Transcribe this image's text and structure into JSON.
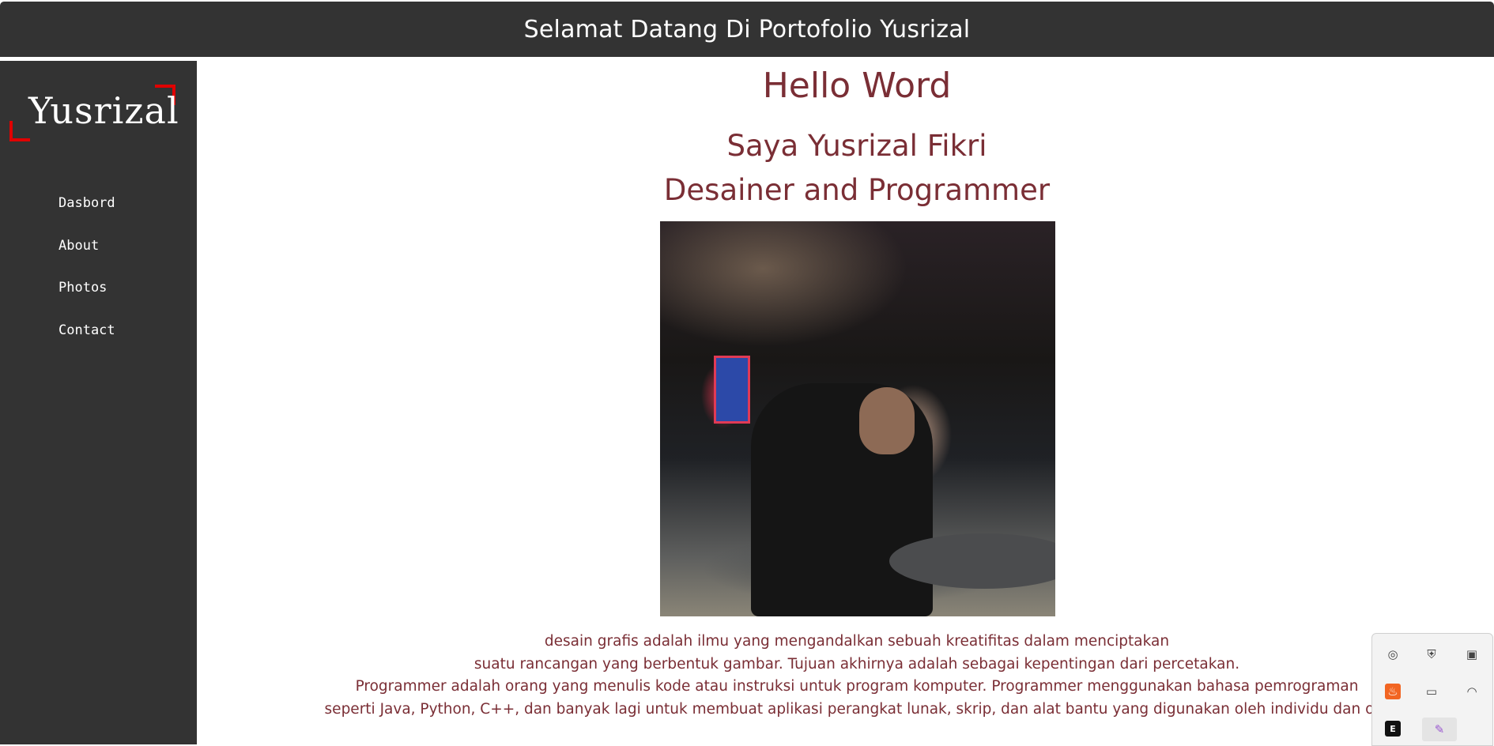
{
  "header": {
    "title": "Selamat Datang Di Portofolio Yusrizal"
  },
  "sidebar": {
    "logo_text": "Yusrizal",
    "items": [
      {
        "label": "Dasbord"
      },
      {
        "label": "About"
      },
      {
        "label": "Photos"
      },
      {
        "label": "Contact"
      }
    ]
  },
  "main": {
    "greeting": "Hello Word",
    "name_line": "Saya Yusrizal Fikri",
    "role_line": "Desainer and Programmer",
    "photo_alt": "photo",
    "description_lines": [
      "desain grafis adalah ilmu yang mengandalkan sebuah kreatifitas dalam menciptakan",
      "suatu rancangan yang berbentuk gambar. Tujuan akhirnya adalah sebagai kepentingan dari percetakan.",
      "Programmer adalah orang yang menulis kode atau instruksi untuk program komputer. Programmer menggunakan bahasa pemrograman",
      "seperti Java, Python, C++, dan banyak lagi untuk membuat aplikasi perangkat lunak, skrip, dan alat bantu yang digunakan oleh individu dan org"
    ]
  },
  "system_tray": {
    "icons": [
      {
        "name": "headset-icon",
        "glyph": "◎"
      },
      {
        "name": "security-shield-icon",
        "glyph": "⛨"
      },
      {
        "name": "camera-icon",
        "glyph": "▣"
      },
      {
        "name": "app-orange-icon",
        "glyph": "♨"
      },
      {
        "name": "battery-icon",
        "glyph": "▭"
      },
      {
        "name": "wifi-icon",
        "glyph": "◠"
      },
      {
        "name": "epic-games-icon",
        "glyph": "E"
      },
      {
        "name": "pen-icon",
        "glyph": "✎"
      }
    ],
    "colors": {
      "orange": "#f26522",
      "purple": "#9b59d0"
    }
  }
}
